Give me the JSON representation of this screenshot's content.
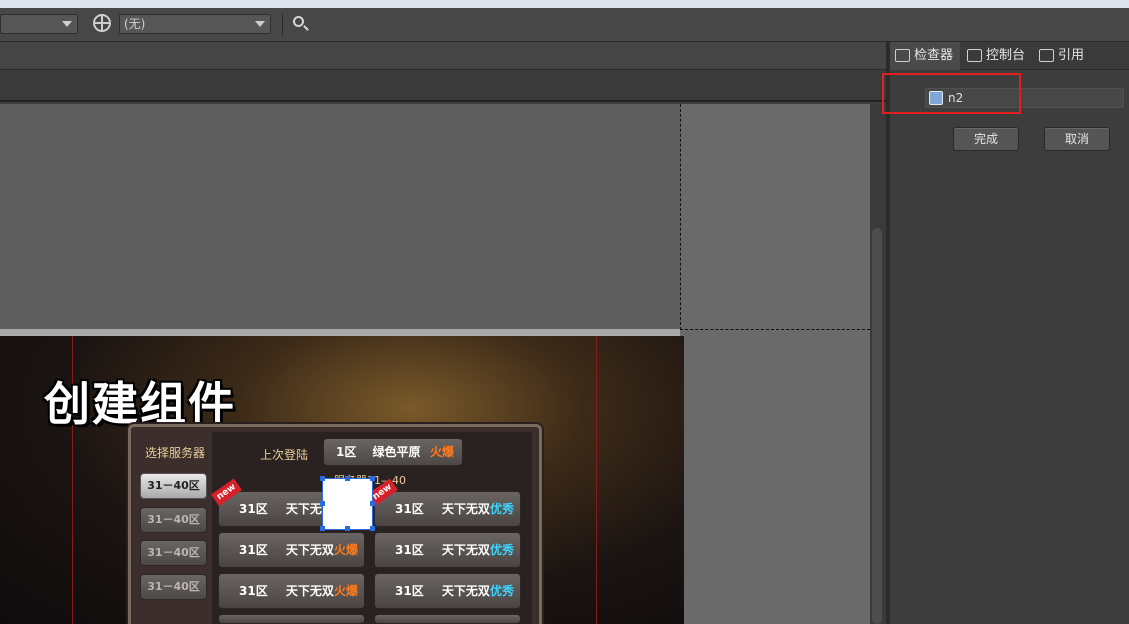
{
  "toolbar": {
    "dropdown1_value": "",
    "dropdown2_value": "(无)",
    "globe_icon": "globe-icon",
    "search_icon": "search-icon"
  },
  "panel": {
    "tabs": [
      {
        "label": "检查器",
        "icon": "inspector-icon"
      },
      {
        "label": "控制台",
        "icon": "monitor-icon"
      },
      {
        "label": "引用",
        "icon": "reference-icon"
      }
    ],
    "name_field_value": "n2",
    "done_label": "完成",
    "cancel_label": "取消"
  },
  "game": {
    "title": "创建组件",
    "select_server_label": "选择服务器",
    "left_buttons": [
      "31－40区",
      "31－40区",
      "31－40区",
      "31－40区"
    ],
    "last_login_label": "上次登陆",
    "last_login": {
      "zone": "1区",
      "name": "绿色平原",
      "status": "火爆"
    },
    "range_label": "服务器31—40",
    "servers": [
      {
        "zone": "31区",
        "name": "天下无双",
        "status": "",
        "new": "new"
      },
      {
        "zone": "31区",
        "name": "天下无双",
        "status": "优秀",
        "new": "new"
      },
      {
        "zone": "31区",
        "name": "天下无双",
        "status": "火爆",
        "new": ""
      },
      {
        "zone": "31区",
        "name": "天下无双",
        "status": "优秀",
        "new": ""
      },
      {
        "zone": "31区",
        "name": "天下无双",
        "status": "火爆",
        "new": ""
      },
      {
        "zone": "31区",
        "name": "天下无双",
        "status": "优秀",
        "new": ""
      }
    ]
  },
  "colors": {
    "highlight_box": "#e02020",
    "selection": "#2a6be0",
    "hot": "#ff7a1a",
    "good": "#3ad4ff"
  }
}
